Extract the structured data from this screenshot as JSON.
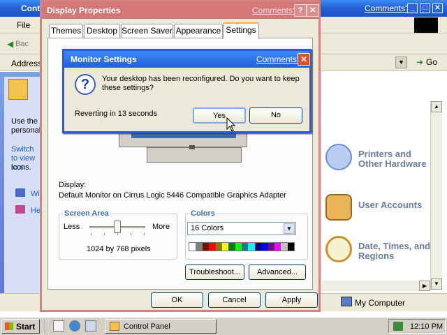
{
  "control_panel": {
    "title": "Cont",
    "help_link": "Comments?",
    "menu_file": "File",
    "back_label": "Bac",
    "address_label": "Address",
    "go_label": "Go",
    "left_text_1": "Use the personal",
    "left_link_1": "Switch to view to s",
    "left_text_2": "icons.",
    "left_link_2": "Wi",
    "left_link_3": "He",
    "categories": [
      "Printers and Other Hardware",
      "User Accounts",
      "Date, Times, and Regions"
    ],
    "status_computer": "My Computer"
  },
  "display_properties": {
    "title": "Display Properties",
    "help_link": "Comments?",
    "help_button": "?",
    "close_button": "✕",
    "tabs": [
      "Themes",
      "Desktop",
      "Screen Saver",
      "Appearance",
      "Settings"
    ],
    "display_label": "Display:",
    "display_value": "Default Monitor on Cirrus Logic 5446 Compatible Graphics Adapter",
    "screen_area": {
      "title": "Screen Area",
      "less": "Less",
      "more": "More",
      "value": "1024 by 768 pixels",
      "slider_level": 0.5
    },
    "colors": {
      "title": "Colors",
      "selected": "16 Colors",
      "palette": [
        "#ffffff",
        "#808080",
        "#800000",
        "#ff0000",
        "#808000",
        "#ffff00",
        "#008000",
        "#00ff00",
        "#008080",
        "#00ffff",
        "#000080",
        "#0000ff",
        "#800080",
        "#ff00ff",
        "#c0c0c0",
        "#000000"
      ]
    },
    "buttons": {
      "troubleshoot": "Troubleshoot...",
      "advanced": "Advanced...",
      "ok": "OK",
      "cancel": "Cancel",
      "apply": "Apply"
    }
  },
  "monitor_settings": {
    "title": "Monitor Settings",
    "help_link": "Comments?",
    "close_button": "✕",
    "message": "Your desktop has been reconfigured.  Do you want to keep these settings?",
    "countdown": "Reverting in 13 seconds",
    "yes": "Yes",
    "no": "No"
  },
  "taskbar": {
    "start": "Start",
    "task_control_panel": "Control Panel",
    "clock": "12:10 PM"
  }
}
